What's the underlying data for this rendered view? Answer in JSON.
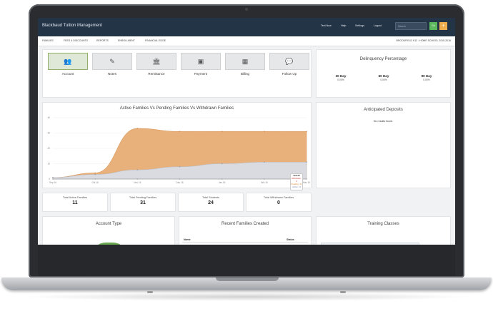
{
  "app": {
    "title": "Blackbaud Tuition Management"
  },
  "topbar": {
    "items": [
      {
        "label": "Test Now",
        "icon": "plus-icon"
      },
      {
        "label": "Help",
        "icon": "question-icon"
      },
      {
        "label": "Settings",
        "icon": "gear-icon"
      },
      {
        "label": "Logout",
        "icon": "user-icon"
      }
    ],
    "search_placeholder": "Search",
    "go_label": "Go",
    "add_label": "+"
  },
  "subnav": {
    "items": [
      "FAMILIES",
      "FEES & DISCOUNTS",
      "REPORTS",
      "ENROLLMENT",
      "FINANCIAL EDGE"
    ],
    "school": "BROOKFIELD K12 : HOME SCHOOL 2015-2016"
  },
  "actions": [
    {
      "label": "Account",
      "icon": "users-icon",
      "active": true
    },
    {
      "label": "Notes",
      "icon": "edit-icon",
      "active": false
    },
    {
      "label": "Remittance",
      "icon": "bank-icon",
      "active": false
    },
    {
      "label": "Payment",
      "icon": "money-icon",
      "active": false
    },
    {
      "label": "Billing",
      "icon": "table-icon",
      "active": false
    },
    {
      "label": "Follow Up",
      "icon": "chat-icon",
      "active": false
    }
  ],
  "delinquency": {
    "title": "Delinquency Percentage",
    "columns": [
      {
        "label": "30 Day",
        "value": "0.00%"
      },
      {
        "label": "60 Day",
        "value": "0.00%"
      },
      {
        "label": "90 Day",
        "value": "0.00%"
      }
    ]
  },
  "deposits": {
    "title": "Anticipated Deposits",
    "empty": "No results found."
  },
  "chart_panel": {
    "title": "Active Families Vs Pending Families Vs Withdrawn Families"
  },
  "chart_data": {
    "type": "area",
    "x": [
      "Sep 16",
      "Oct 16",
      "Nov 16",
      "Dec 16",
      "Jan 16",
      "Feb 16",
      "Mar 16"
    ],
    "ylim": [
      0,
      40
    ],
    "yticks": [
      "40",
      "30",
      "20",
      "10",
      "0"
    ],
    "series": [
      {
        "name": "Pending",
        "color": "#e8b07a",
        "values": [
          1,
          4,
          33,
          31,
          31,
          31,
          31
        ]
      },
      {
        "name": "Active",
        "color": "#d9dbe0",
        "values": [
          1,
          3,
          6,
          8,
          10,
          11,
          11
        ]
      },
      {
        "name": "Withdrawn",
        "color": "#c4c8cf",
        "values": [
          0,
          0,
          0,
          0,
          0,
          0,
          0
        ]
      }
    ],
    "tooltip": {
      "title": "Feb 16",
      "lines": [
        "Withdrawn: 0",
        "Pending: 31",
        "Active: 11"
      ]
    }
  },
  "stats": [
    {
      "label": "Total Active Families",
      "value": "11"
    },
    {
      "label": "Total Pending Families",
      "value": "31"
    },
    {
      "label": "Total Students",
      "value": "24"
    },
    {
      "label": "Total Withdrawn Families",
      "value": "0"
    }
  ],
  "bottom": {
    "account_type": "Account Type",
    "recent": {
      "title": "Recent Families Created",
      "col_name": "Name",
      "col_status": "Status"
    },
    "training": "Training Classes"
  }
}
